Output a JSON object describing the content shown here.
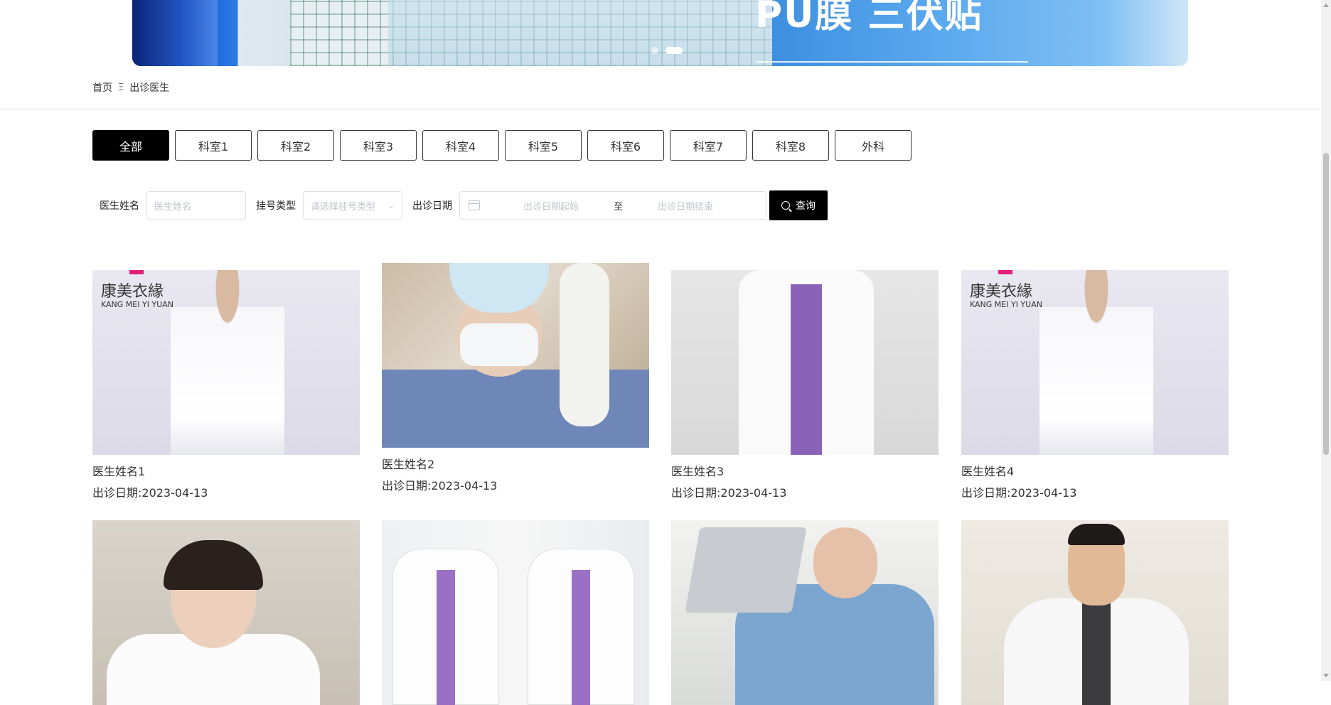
{
  "banner": {
    "headline": "PU膜 三伏贴",
    "dots": 2,
    "active_dot": 2
  },
  "breadcrumb": {
    "home": "首页",
    "separator": "Ξ",
    "current": "出诊医生"
  },
  "tabs": [
    {
      "label": "全部",
      "active": true
    },
    {
      "label": "科室1"
    },
    {
      "label": "科室2"
    },
    {
      "label": "科室3"
    },
    {
      "label": "科室4"
    },
    {
      "label": "科室5"
    },
    {
      "label": "科室6"
    },
    {
      "label": "科室7"
    },
    {
      "label": "科室8"
    },
    {
      "label": "外科"
    }
  ],
  "search": {
    "doctor_label": "医生姓名",
    "doctor_placeholder": "医生姓名",
    "type_label": "挂号类型",
    "type_placeholder": "请选择挂号类型",
    "date_label": "出诊日期",
    "date_start_placeholder": "出诊日期起始",
    "date_to": "至",
    "date_end_placeholder": "出诊日期结束",
    "query_label": "查询"
  },
  "doctors": [
    {
      "name": "医生姓名1",
      "date": "出诊日期:2023-04-13",
      "image": "coat-logo",
      "logo": "康美衣緣",
      "logo_sub": "KANG MEI YI YUAN"
    },
    {
      "name": "医生姓名2",
      "date": "出诊日期:2023-04-13",
      "image": "surgeon"
    },
    {
      "name": "医生姓名3",
      "date": "出诊日期:2023-04-13",
      "image": "labcoat"
    },
    {
      "name": "医生姓名4",
      "date": "出诊日期:2023-04-13",
      "image": "coat-logo",
      "logo": "康美衣緣",
      "logo_sub": "KANG MEI YI YUAN"
    },
    {
      "image": "smiling-doctor"
    },
    {
      "image": "twin-labcoat"
    },
    {
      "image": "laptop-doctor"
    },
    {
      "image": "male-doctor"
    }
  ],
  "colors": {
    "active_tab_bg": "#000000",
    "border": "#333333",
    "placeholder": "#c0c4cc"
  }
}
